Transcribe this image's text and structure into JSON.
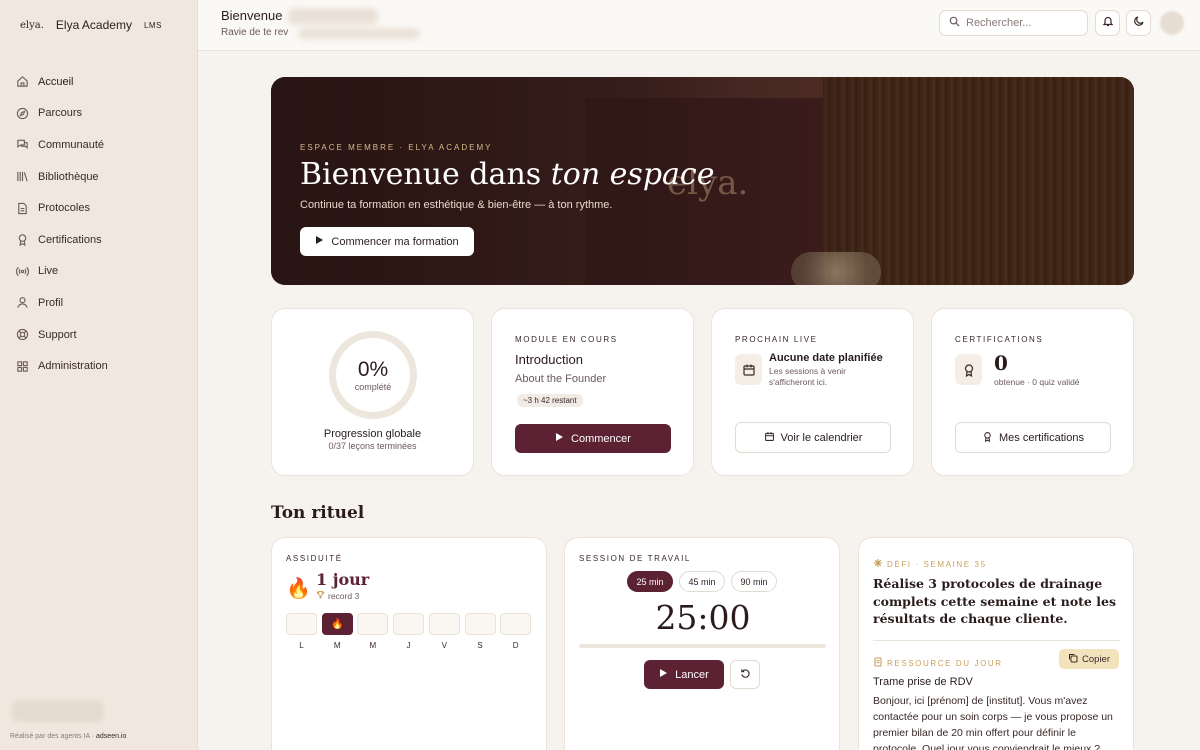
{
  "sidebar": {
    "logo": "elya.",
    "brand": "Elya Academy",
    "tag": "LMS",
    "items": [
      {
        "label": "Accueil",
        "icon": "home-icon"
      },
      {
        "label": "Parcours",
        "icon": "compass-icon"
      },
      {
        "label": "Communauté",
        "icon": "chat-icon"
      },
      {
        "label": "Bibliothèque",
        "icon": "library-icon"
      },
      {
        "label": "Protocoles",
        "icon": "file-icon"
      },
      {
        "label": "Certifications",
        "icon": "award-icon"
      },
      {
        "label": "Live",
        "icon": "broadcast-icon"
      },
      {
        "label": "Profil",
        "icon": "user-icon"
      },
      {
        "label": "Support",
        "icon": "lifebuoy-icon"
      },
      {
        "label": "Administration",
        "icon": "grid-icon"
      }
    ],
    "footer_prefix": "Réalisé par des agents IA ·",
    "footer_link": "adseen.io"
  },
  "header": {
    "title": "Bienvenue",
    "subtitle": "Ravie de te rev",
    "search_placeholder": "Rechercher..."
  },
  "hero": {
    "eyebrow": "ESPACE MEMBRE · ELYA ACADEMY",
    "title_main": "Bienvenue dans ",
    "title_em": "ton espace",
    "watermark": "elya.",
    "subtitle": "Continue ta formation en esthétique & bien-être — à ton rythme.",
    "cta": "Commencer ma formation"
  },
  "cards": {
    "progress": {
      "value": "0%",
      "label": "complété",
      "title": "Progression globale",
      "sub": "0/37 leçons terminées"
    },
    "module": {
      "eyebrow": "MODULE EN COURS",
      "title": "Introduction",
      "subtitle": "About the Founder",
      "time": "~3 h 42 restant",
      "cta": "Commencer"
    },
    "live": {
      "eyebrow": "PROCHAIN LIVE",
      "title": "Aucune date planifiée",
      "sub1": "Les sessions à venir",
      "sub2": "s'afficheront ici.",
      "cta": "Voir le calendrier"
    },
    "certs": {
      "eyebrow": "CERTIFICATIONS",
      "count": "0",
      "sub": "obtenue · 0 quiz validé",
      "cta": "Mes certifications"
    }
  },
  "ritual": {
    "title": "Ton rituel",
    "assiduite": {
      "eyebrow": "ASSIDUITÉ",
      "streak": "1 jour",
      "record": "record 3",
      "days": [
        "L",
        "M",
        "M",
        "J",
        "V",
        "S",
        "D"
      ],
      "active_day_index": 1
    },
    "session": {
      "eyebrow": "SESSION DE TRAVAIL",
      "durations": [
        "25 min",
        "45 min",
        "90 min"
      ],
      "selected": 0,
      "timer": "25:00",
      "progress": 0,
      "cta": "Lancer"
    },
    "defi": {
      "eyebrow": "DÉFI · SEMAINE 35",
      "text": "Réalise 3 protocoles de drainage complets cette semaine et note les résultats de chaque cliente.",
      "resource_eyebrow": "RESSOURCE DU JOUR",
      "copy": "Copier",
      "resource_title": "Trame prise de RDV",
      "resource_text": "Bonjour, ici [prénom] de [institut]. Vous m'avez contactée pour un soin corps — je vous propose un premier bilan de 20 min offert pour définir le protocole. Quel jour vous conviendrait le mieux ?"
    }
  },
  "colors": {
    "accent": "#5c2233",
    "gold": "#c9a05a",
    "background": "#f6f2ed"
  }
}
